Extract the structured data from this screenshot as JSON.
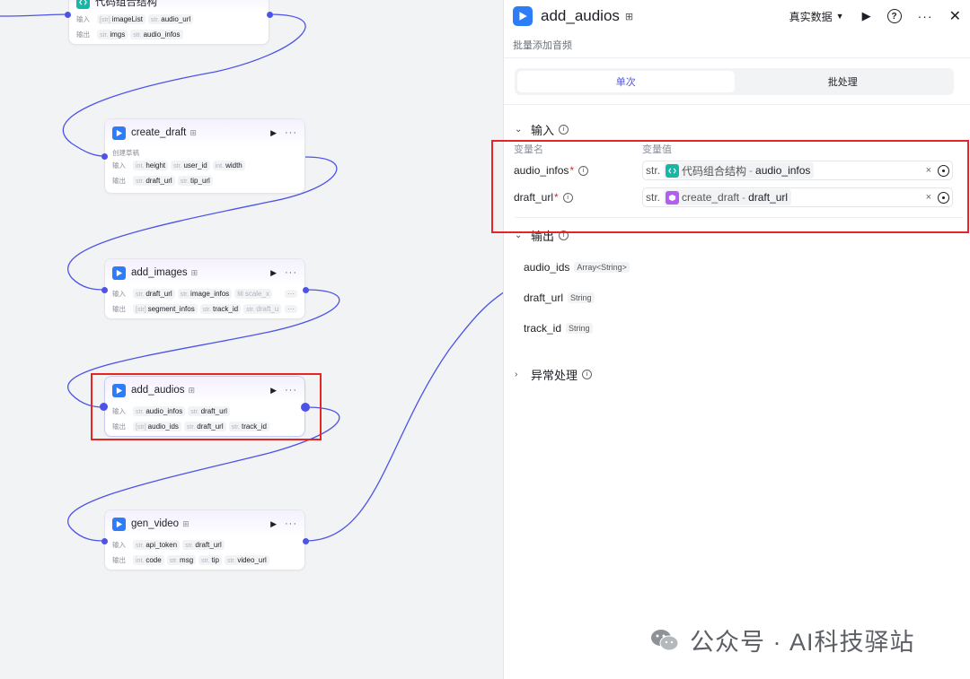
{
  "canvas": {
    "nodes": [
      {
        "key": "code",
        "title": "代码组合结构",
        "desc": "",
        "rows": [
          {
            "label": "输入",
            "tags": [
              {
                "t": "[str]",
                "n": "imageList"
              },
              {
                "t": "str.",
                "n": "audio_url"
              }
            ]
          },
          {
            "label": "输出",
            "tags": [
              {
                "t": "str.",
                "n": "imgs"
              },
              {
                "t": "str.",
                "n": "audio_infos"
              }
            ]
          }
        ]
      },
      {
        "key": "create_draft",
        "title": "create_draft",
        "desc": "创建草稿",
        "rows": [
          {
            "label": "输入",
            "tags": [
              {
                "t": "int.",
                "n": "height"
              },
              {
                "t": "str.",
                "n": "user_id"
              },
              {
                "t": "int.",
                "n": "width"
              }
            ]
          },
          {
            "label": "输出",
            "tags": [
              {
                "t": "str.",
                "n": "draft_url"
              },
              {
                "t": "str.",
                "n": "tip_url"
              }
            ]
          }
        ]
      },
      {
        "key": "add_images",
        "title": "add_images",
        "desc": "",
        "rows": [
          {
            "label": "输入",
            "tags": [
              {
                "t": "str.",
                "n": "draft_url"
              },
              {
                "t": "str.",
                "n": "image_infos"
              },
              {
                "t": "fill",
                "n": "scale_x"
              }
            ],
            "more": "···"
          },
          {
            "label": "输出",
            "tags": [
              {
                "t": "[str]",
                "n": "segment_infos"
              },
              {
                "t": "str.",
                "n": "track_id"
              },
              {
                "t": "str.",
                "n": "draft_u"
              }
            ],
            "more": "···"
          }
        ]
      },
      {
        "key": "add_audios",
        "title": "add_audios",
        "desc": "",
        "rows": [
          {
            "label": "输入",
            "tags": [
              {
                "t": "str.",
                "n": "audio_infos"
              },
              {
                "t": "str.",
                "n": "draft_url"
              }
            ]
          },
          {
            "label": "输出",
            "tags": [
              {
                "t": "[str]",
                "n": "audio_ids"
              },
              {
                "t": "str.",
                "n": "draft_url"
              },
              {
                "t": "str.",
                "n": "track_id"
              }
            ]
          }
        ]
      },
      {
        "key": "gen_video",
        "title": "gen_video",
        "desc": "",
        "rows": [
          {
            "label": "输入",
            "tags": [
              {
                "t": "str.",
                "n": "api_token"
              },
              {
                "t": "str.",
                "n": "draft_url"
              }
            ]
          },
          {
            "label": "输出",
            "tags": [
              {
                "t": "int.",
                "n": "code"
              },
              {
                "t": "str.",
                "n": "msg"
              },
              {
                "t": "str.",
                "n": "tip"
              },
              {
                "t": "str.",
                "n": "video_url"
              }
            ]
          }
        ]
      }
    ]
  },
  "panel": {
    "title": "add_audios",
    "subtitle": "批量添加音频",
    "data_mode": "真实数据",
    "tabs": [
      {
        "label": "单次",
        "active": true
      },
      {
        "label": "批处理",
        "active": false
      }
    ],
    "input_section": {
      "title": "输入",
      "col_name": "变量名",
      "col_value": "变量值",
      "rows": [
        {
          "name": "audio_infos",
          "type": "str.",
          "source": "代码组合结构",
          "field": "audio_infos",
          "icon": "code-icon"
        },
        {
          "name": "draft_url",
          "type": "str.",
          "source": "create_draft",
          "field": "draft_url",
          "icon": "plugin-icon"
        }
      ]
    },
    "output_section": {
      "title": "输出",
      "rows": [
        {
          "name": "audio_ids",
          "type": "Array<String>"
        },
        {
          "name": "draft_url",
          "type": "String"
        },
        {
          "name": "track_id",
          "type": "String"
        }
      ]
    },
    "error_section": {
      "title": "异常处理"
    }
  },
  "watermark": {
    "text": "公众号 · AI科技驿站"
  },
  "colors": {
    "accent": "#4d53e8",
    "node_icon": "#2c7df7",
    "highlight": "#e62525",
    "code_icon": "#15b8a6",
    "plugin_icon": "#b05ff0"
  }
}
